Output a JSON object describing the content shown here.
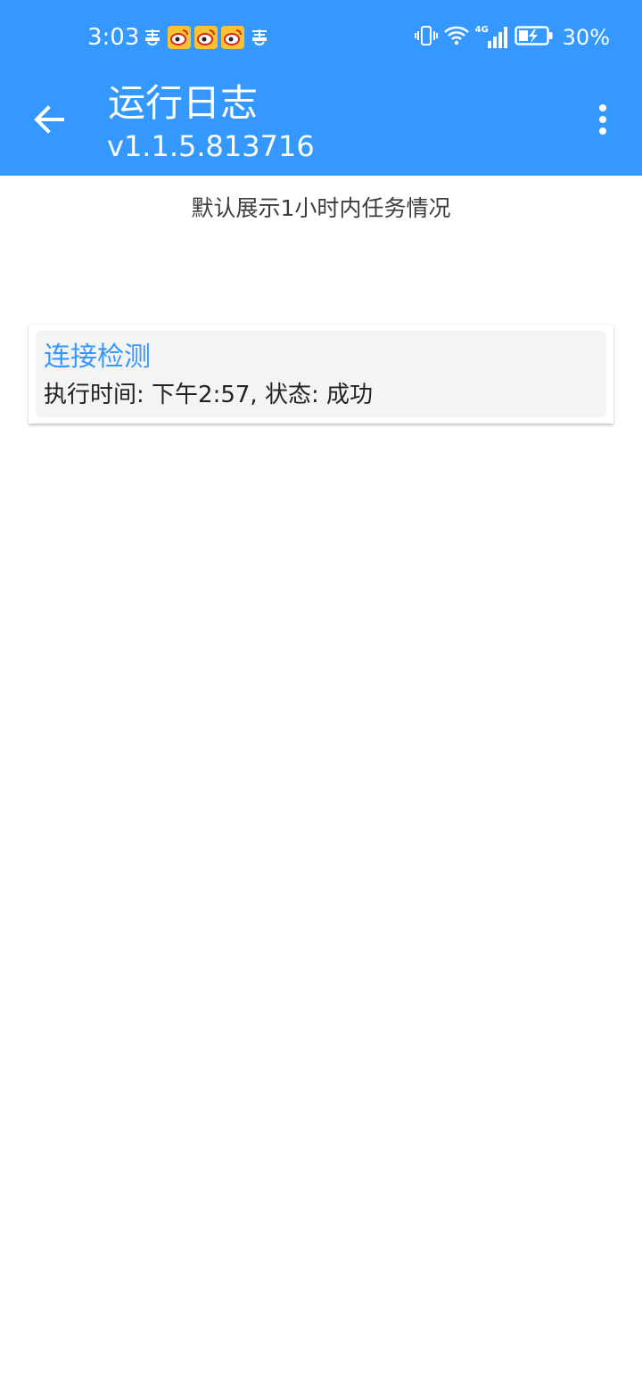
{
  "status_bar": {
    "time": "3:03",
    "notification_icons": [
      "huiyi-app-icon",
      "weibo-icon",
      "weibo-icon",
      "weibo-icon",
      "huiyi-app-icon"
    ],
    "system_icons": [
      "vibrate-icon",
      "wifi-icon",
      "4g-signal-icon",
      "battery-charging-icon"
    ],
    "network_label": "4G",
    "battery_percent": "30%"
  },
  "app_bar": {
    "title": "运行日志",
    "subtitle": "v1.1.5.813716",
    "back_icon": "arrow-back-icon",
    "menu_icon": "more-vertical-icon"
  },
  "main": {
    "hint": "默认展示1小时内任务情况",
    "log_items": [
      {
        "title": "连接检测",
        "detail": "执行时间: 下午2:57, 状态:  成功"
      }
    ]
  },
  "colors": {
    "primary": "#3598FE",
    "card_bg": "#F4F4F4",
    "text_dark": "#222222",
    "text_hint": "#3D3D3D"
  }
}
